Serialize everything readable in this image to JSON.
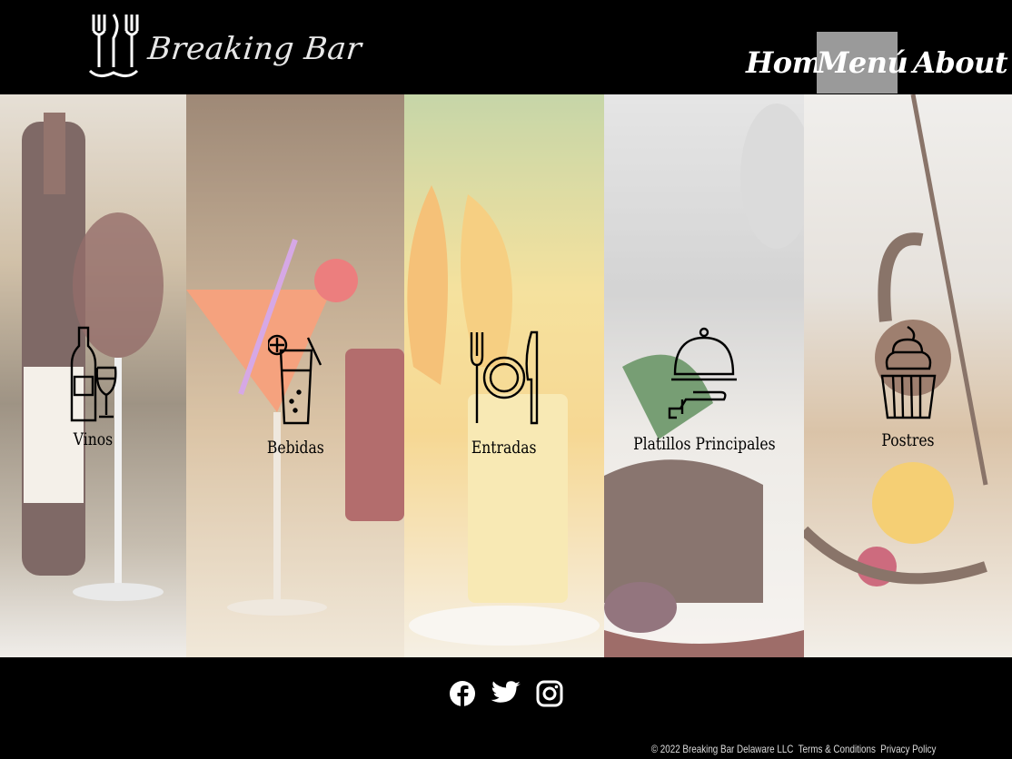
{
  "brand": {
    "name": "Breaking Bar",
    "logo_icon": "cutlery-logo-icon"
  },
  "nav": {
    "items": [
      {
        "label": "Home",
        "active": false
      },
      {
        "label": "Menú",
        "active": true
      },
      {
        "label": "About us",
        "active": false
      }
    ],
    "active_bg": "#9a9a9a"
  },
  "categories": [
    {
      "label": "Vinos",
      "icon": "wine-bottle-glass-icon"
    },
    {
      "label": "Bebidas",
      "icon": "cocktail-glass-icon"
    },
    {
      "label": "Entradas",
      "icon": "plate-fork-knife-icon"
    },
    {
      "label": "Platillos  Principales",
      "icon": "serving-cloche-icon"
    },
    {
      "label": "Postres",
      "icon": "cupcake-icon"
    }
  ],
  "footer": {
    "social": [
      "facebook-icon",
      "twitter-icon",
      "instagram-icon"
    ],
    "copyright": "© 2022 Breaking Bar Delaware LLC",
    "terms": "Terms & Conditions",
    "privacy": "Privacy Policy"
  }
}
